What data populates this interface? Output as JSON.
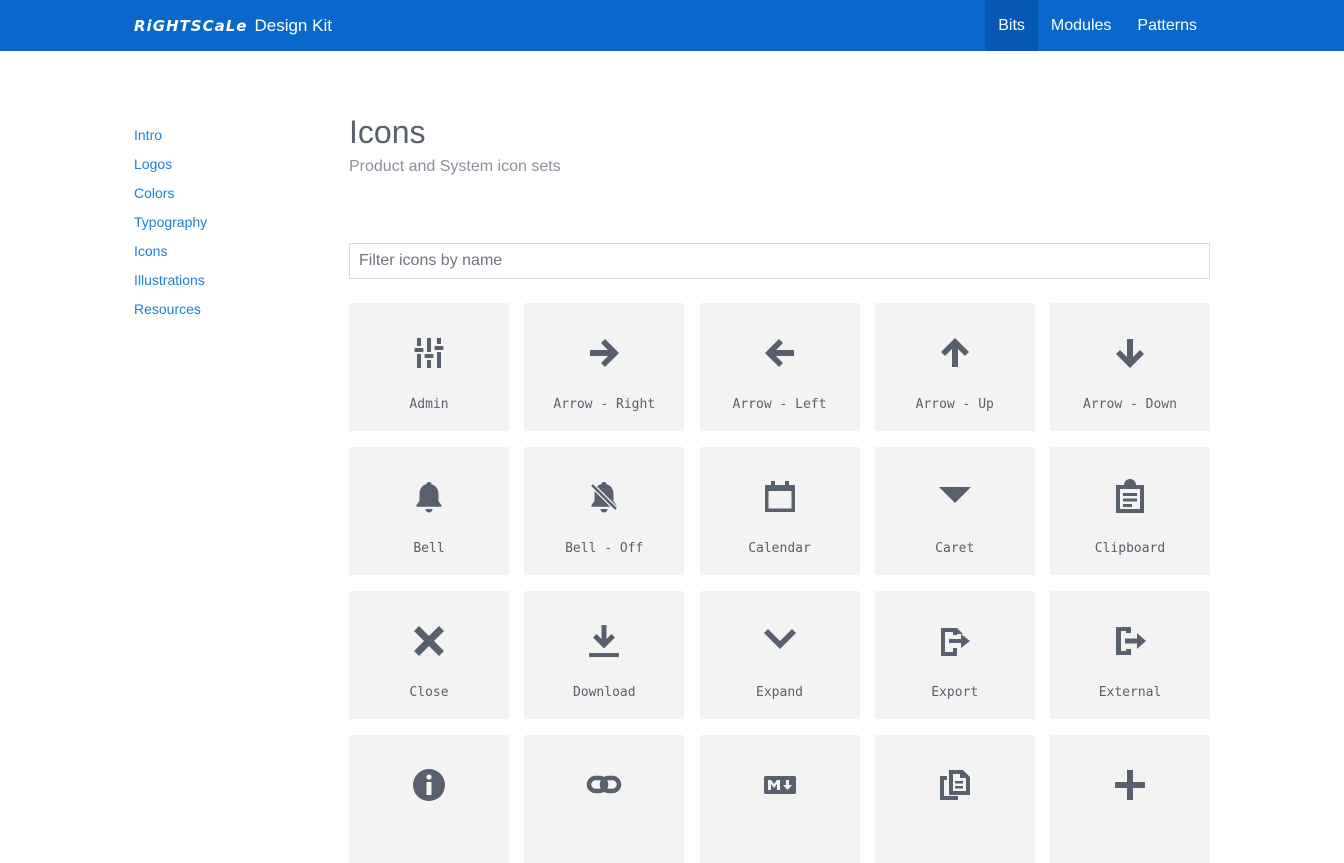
{
  "header": {
    "logo_text": "RiGHTSCaLe",
    "app_title": "Design Kit",
    "nav": [
      {
        "label": "Bits",
        "active": true
      },
      {
        "label": "Modules",
        "active": false
      },
      {
        "label": "Patterns",
        "active": false
      }
    ]
  },
  "sidebar": {
    "items": [
      {
        "label": "Intro"
      },
      {
        "label": "Logos"
      },
      {
        "label": "Colors"
      },
      {
        "label": "Typography"
      },
      {
        "label": "Icons"
      },
      {
        "label": "Illustrations"
      },
      {
        "label": "Resources"
      }
    ]
  },
  "main": {
    "title": "Icons",
    "subtitle": "Product and System icon sets",
    "filter_placeholder": "Filter icons by name",
    "filter_value": ""
  },
  "icons": [
    {
      "label": "Admin",
      "icon": "admin-icon"
    },
    {
      "label": "Arrow - Right",
      "icon": "arrow-right-icon"
    },
    {
      "label": "Arrow - Left",
      "icon": "arrow-left-icon"
    },
    {
      "label": "Arrow - Up",
      "icon": "arrow-up-icon"
    },
    {
      "label": "Arrow - Down",
      "icon": "arrow-down-icon"
    },
    {
      "label": "Bell",
      "icon": "bell-icon"
    },
    {
      "label": "Bell - Off",
      "icon": "bell-off-icon"
    },
    {
      "label": "Calendar",
      "icon": "calendar-icon"
    },
    {
      "label": "Caret",
      "icon": "caret-icon"
    },
    {
      "label": "Clipboard",
      "icon": "clipboard-icon"
    },
    {
      "label": "Close",
      "icon": "close-icon"
    },
    {
      "label": "Download",
      "icon": "download-icon"
    },
    {
      "label": "Expand",
      "icon": "expand-icon"
    },
    {
      "label": "Export",
      "icon": "export-icon"
    },
    {
      "label": "External",
      "icon": "external-icon"
    },
    {
      "label": "",
      "icon": "info-icon"
    },
    {
      "label": "",
      "icon": "link-icon"
    },
    {
      "label": "",
      "icon": "markdown-icon"
    },
    {
      "label": "",
      "icon": "copy-icon"
    },
    {
      "label": "",
      "icon": "plus-icon"
    }
  ],
  "colors": {
    "brand_blue": "#0868cc",
    "active_nav": "#0657b4",
    "link_blue": "#1d7fd6",
    "tile_bg": "#f3f3f3",
    "icon_gray": "#58606e"
  }
}
